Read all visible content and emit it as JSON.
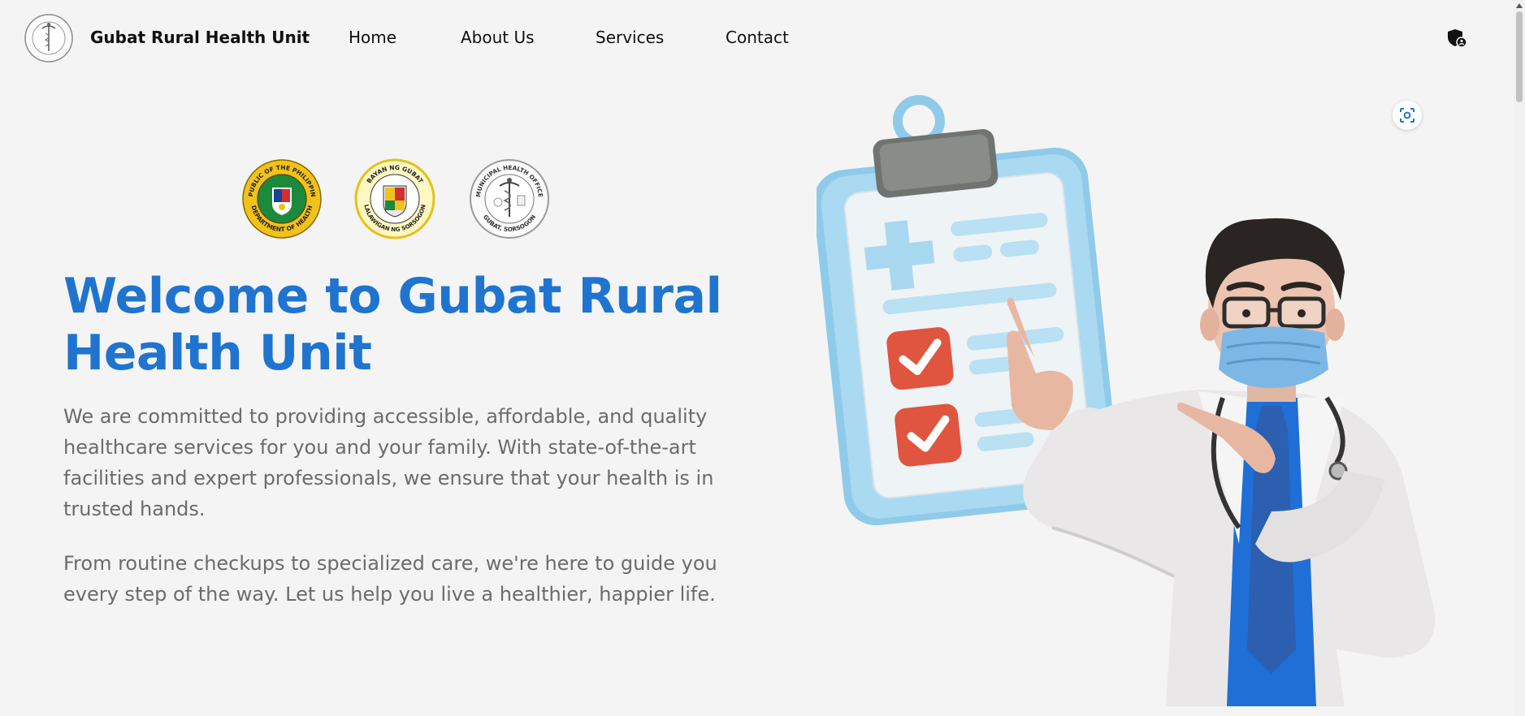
{
  "header": {
    "brand_name": "Gubat Rural Health Unit",
    "nav": {
      "home": "Home",
      "about": "About Us",
      "services": "Services",
      "contact": "Contact"
    }
  },
  "hero": {
    "title": "Welcome to Gubat Rural Health Unit",
    "paragraph_1": "We are committed to providing accessible, affordable, and quality healthcare services for you and your family. With state-of-the-art facilities and expert professionals, we ensure that your health is in trusted hands.",
    "paragraph_2": "From routine checkups to specialized care, we're here to guide you every step of the way. Let us help you live a healthier, happier life."
  },
  "seals": {
    "doh_top": "REPUBLIC OF THE PHILIPPINES",
    "doh_bottom": "DEPARTMENT OF HEALTH",
    "gubat_top": "BAYAN NG GUBAT",
    "gubat_bottom": "LALAWIGAN NG SORSOGON",
    "mho_top": "MUNICIPAL HEALTH OFFICE",
    "mho_bottom": "GUBAT, SORSOGON"
  },
  "icons": {
    "admin": "shield-user-icon",
    "scan": "scan-icon"
  },
  "colors": {
    "accent": "#1f74cf",
    "body_text": "#6b6b6b",
    "background": "#f4f4f4"
  }
}
